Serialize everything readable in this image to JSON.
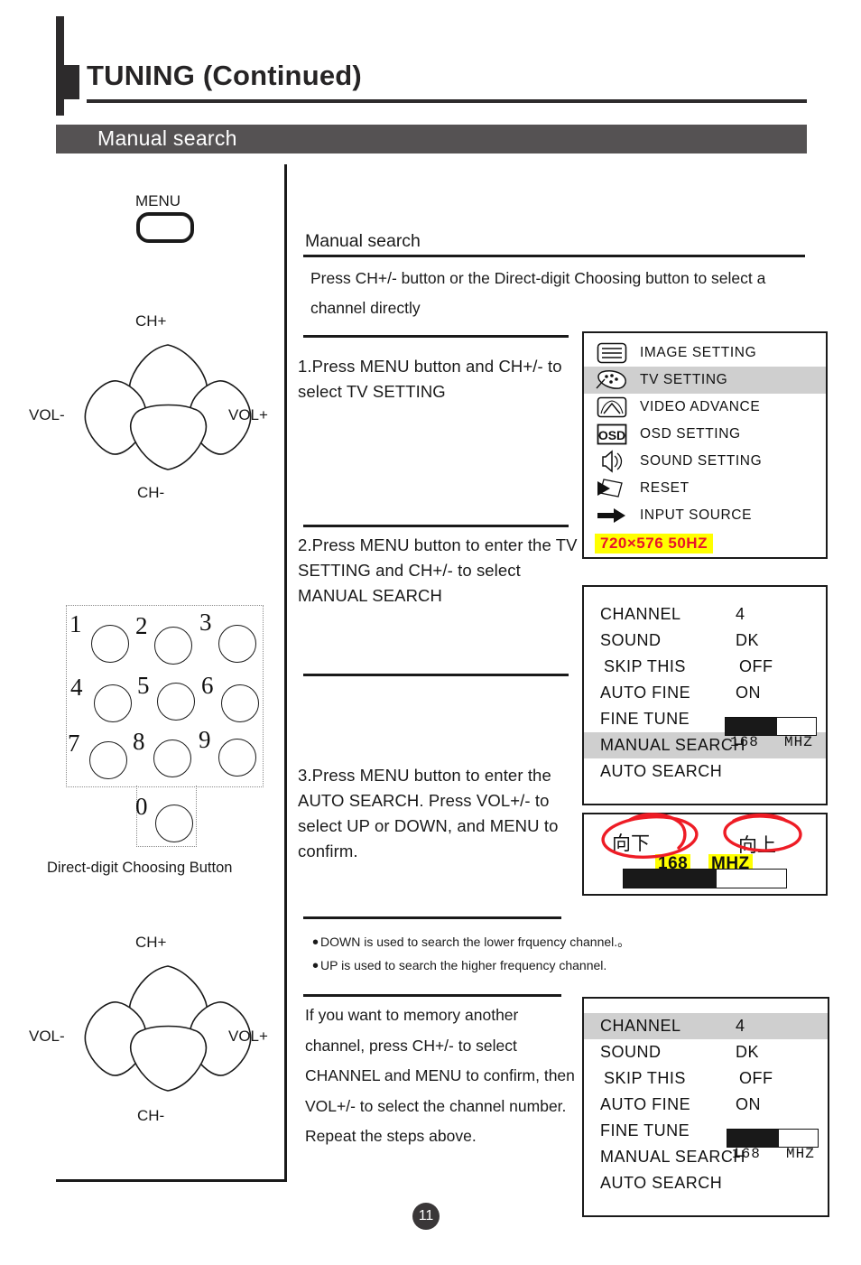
{
  "header": {
    "title": "TUNING (Continued)",
    "section_bar_label": "Manual search"
  },
  "remote": {
    "menu_label": "MENU",
    "dpad_top": {
      "ch_up": "CH+",
      "ch_down": "CH-",
      "vol_down": "VOL-",
      "vol_up": "VOL+"
    },
    "dpad_bottom": {
      "ch_up": "CH+",
      "ch_down": "CH-",
      "vol_down": "VOL-",
      "vol_up": "VOL+"
    },
    "keypad": {
      "keys": [
        "1",
        "2",
        "3",
        "4",
        "5",
        "6",
        "7",
        "8",
        "9",
        "0"
      ],
      "caption": "Direct-digit Choosing Button"
    }
  },
  "content": {
    "heading": "Manual search",
    "intro": "Press CH+/- button or the Direct-digit Choosing button to select a channel directly",
    "step1": "1.Press MENU button and CH+/- to select TV SETTING",
    "step2": "2.Press MENU button to enter the TV SETTING and CH+/- to select MANUAL SEARCH",
    "step3": "3.Press MENU button to enter the AUTO SEARCH. Press VOL+/- to select UP or DOWN, and MENU to confirm.",
    "note1": "DOWN is used to search the lower frquency channel.。",
    "note2": "UP is used to search the higher frequency channel.",
    "closing": "If you want to memory another channel, press CH+/- to select CHANNEL and MENU to confirm, then VOL+/- to select the channel number. Repeat the steps above."
  },
  "osd_main_menu": {
    "items": [
      {
        "label": "IMAGE SETTING",
        "icon": "lines-screen-icon",
        "selected": false
      },
      {
        "label": "TV SETTING",
        "icon": "gamepad-icon",
        "selected": true
      },
      {
        "label": "VIDEO ADVANCE",
        "icon": "video-waves-icon",
        "selected": false
      },
      {
        "label": "OSD SETTING",
        "icon": "osd-icon",
        "selected": false
      },
      {
        "label": "SOUND SETTING",
        "icon": "speaker-icon",
        "selected": false
      },
      {
        "label": "RESET",
        "icon": "reset-arrow-icon",
        "selected": false
      },
      {
        "label": "INPUT SOURCE",
        "icon": "right-arrow-icon",
        "selected": false
      }
    ],
    "resolution_badge": "720×576    50HZ"
  },
  "osd_tv_setting_a": {
    "rows": [
      {
        "name": "CHANNEL",
        "value": "4",
        "selected": false
      },
      {
        "name": "SOUND",
        "value": "DK",
        "selected": false
      },
      {
        "name": "SKIP THIS",
        "value": "OFF",
        "selected": false
      },
      {
        "name": "AUTO FINE",
        "value": "ON",
        "selected": false
      },
      {
        "name": "FINE TUNE",
        "value": "",
        "selected": false
      },
      {
        "name": "MANUAL SEARCH",
        "value": "",
        "selected": true
      },
      {
        "name": "AUTO SEARCH",
        "value": "",
        "selected": false
      }
    ],
    "fine_tune_value": "168",
    "fine_tune_unit": "MHZ",
    "fine_tune_percent": 57
  },
  "osd_search_bar": {
    "label_down": "向下",
    "label_up": "向上",
    "value": "168",
    "unit": "MHZ",
    "percent": 57
  },
  "osd_tv_setting_b": {
    "rows": [
      {
        "name": "CHANNEL",
        "value": "4",
        "selected": true
      },
      {
        "name": "SOUND",
        "value": "DK",
        "selected": false
      },
      {
        "name": "SKIP THIS",
        "value": "OFF",
        "selected": false
      },
      {
        "name": "AUTO FINE",
        "value": "ON",
        "selected": false
      },
      {
        "name": "FINE TUNE",
        "value": "",
        "selected": false
      },
      {
        "name": "MANUAL SEARCH",
        "value": "",
        "selected": false
      },
      {
        "name": "AUTO SEARCH",
        "value": "",
        "selected": false
      }
    ],
    "fine_tune_value": "168",
    "fine_tune_unit": "MHZ",
    "fine_tune_percent": 57
  },
  "footer": {
    "page_number": "11"
  },
  "colors": {
    "ink": "#1a1a1a",
    "section_bar": "#555253",
    "highlight_row": "#cfcfcf",
    "annotation_red": "#ee1c25",
    "marker_yellow": "#ffff00",
    "osd_red_text": "#e8132b"
  }
}
